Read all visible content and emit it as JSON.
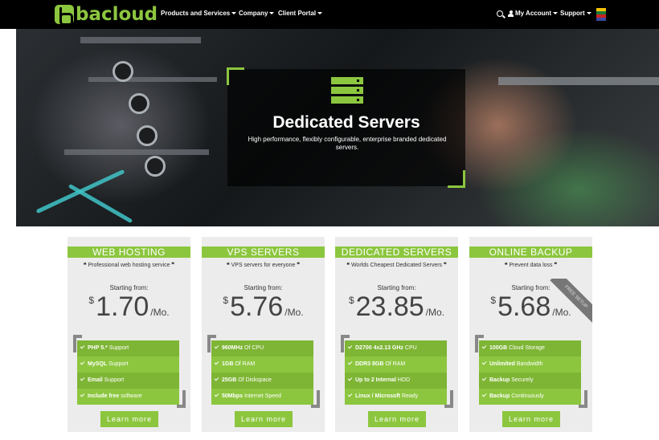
{
  "brand": {
    "name": "bacloud",
    "accent": "#8cc63f"
  },
  "nav": {
    "items": [
      {
        "label": "Products and Services"
      },
      {
        "label": "Company"
      },
      {
        "label": "Client Portal"
      }
    ],
    "account_label": "My Account",
    "support_label": "Support",
    "icons": [
      "search-icon",
      "user-icon",
      "flag-icon"
    ]
  },
  "hero": {
    "title": "Dedicated Servers",
    "subtitle": "High performance, flexibly configurable, enterprise branded dedicated servers."
  },
  "plans": [
    {
      "title": "WEB HOSTING",
      "tagline": "Professional web hosting service",
      "starting_label": "Starting from:",
      "currency": "$",
      "price": "1.70",
      "period": "/Mo.",
      "features": [
        {
          "strong": "PHP 5.*",
          "rest": " Support"
        },
        {
          "strong": "MySQL",
          "rest": " Support"
        },
        {
          "strong": "Email",
          "rest": " Support"
        },
        {
          "strong": "Include free",
          "rest": " software"
        }
      ],
      "button": "Learn more"
    },
    {
      "title": "VPS SERVERS",
      "tagline": "VPS servers for everyone",
      "starting_label": "Starting from:",
      "currency": "$",
      "price": "5.76",
      "period": "/Mo.",
      "features": [
        {
          "strong": "960MHz",
          "rest": " Of CPU"
        },
        {
          "strong": "1GB",
          "rest": " Of RAM"
        },
        {
          "strong": "25GB",
          "rest": " Of Diskspace"
        },
        {
          "strong": "50Mbps",
          "rest": " Internet Speed"
        }
      ],
      "button": "Learn more"
    },
    {
      "title": "DEDICATED SERVERS",
      "tagline": "Worlds Cheapest Dedicated Servers",
      "starting_label": "Starting from:",
      "currency": "$",
      "price": "23.85",
      "period": "/Mo.",
      "features": [
        {
          "strong": "D2700 4x2.13 GHz",
          "rest": " CPU"
        },
        {
          "strong": "DDR3 8GB",
          "rest": " Of RAM"
        },
        {
          "strong": "Up to 2 Internal",
          "rest": " HDD"
        },
        {
          "strong": "Linux / Microsoft",
          "rest": " Ready"
        }
      ],
      "button": "Learn more"
    },
    {
      "title": "ONLINE BACKUP",
      "tagline": "Prevent data loss",
      "starting_label": "Starting from:",
      "currency": "$",
      "price": "5.68",
      "period": "/Mo.",
      "ribbon": "FREE SETUP",
      "features": [
        {
          "strong": "100GB",
          "rest": " Cloud Storage"
        },
        {
          "strong": "Unlimited",
          "rest": " Bandwidth"
        },
        {
          "strong": "Backup",
          "rest": " Securely"
        },
        {
          "strong": "Backup",
          "rest": " Continuously"
        }
      ],
      "button": "Learn more"
    }
  ]
}
